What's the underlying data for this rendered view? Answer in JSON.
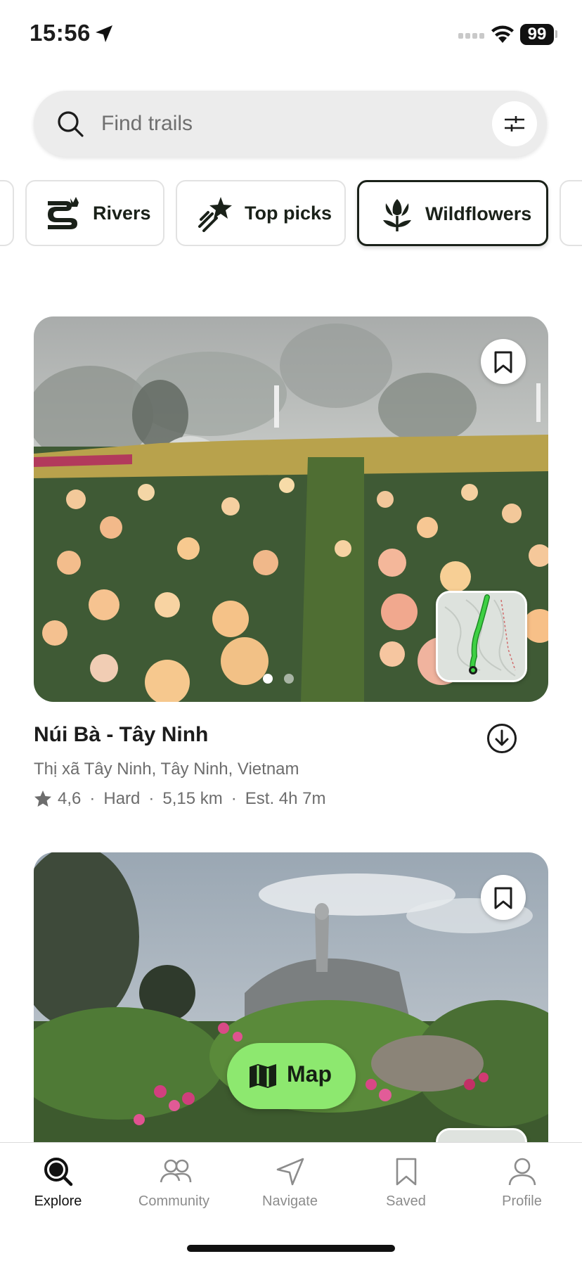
{
  "status": {
    "time": "15:56",
    "battery": "99"
  },
  "search": {
    "placeholder": "Find trails"
  },
  "chips": [
    {
      "label": "Rivers",
      "icon": "rivers-icon"
    },
    {
      "label": "Top picks",
      "icon": "shooting-star-icon"
    },
    {
      "label": "Wildflowers",
      "icon": "wildflower-icon",
      "active": true
    }
  ],
  "trails": [
    {
      "name": "Núi Bà - Tây Ninh",
      "location": "Thị xã Tây Ninh, Tây Ninh, Vietnam",
      "rating": "4,6",
      "difficulty": "Hard",
      "distance": "5,15 km",
      "duration": "Est. 4h 7m",
      "photo_count": 2,
      "active_photo": 1
    }
  ],
  "map_button": {
    "label": "Map"
  },
  "tabs": [
    {
      "label": "Explore",
      "icon": "explore-icon",
      "active": true
    },
    {
      "label": "Community",
      "icon": "community-icon"
    },
    {
      "label": "Navigate",
      "icon": "navigate-icon"
    },
    {
      "label": "Saved",
      "icon": "bookmark-icon"
    },
    {
      "label": "Profile",
      "icon": "profile-icon"
    }
  ],
  "colors": {
    "accent_green": "#8de86f",
    "dark_text": "#1a2119",
    "muted_text": "#6d6d6d"
  }
}
